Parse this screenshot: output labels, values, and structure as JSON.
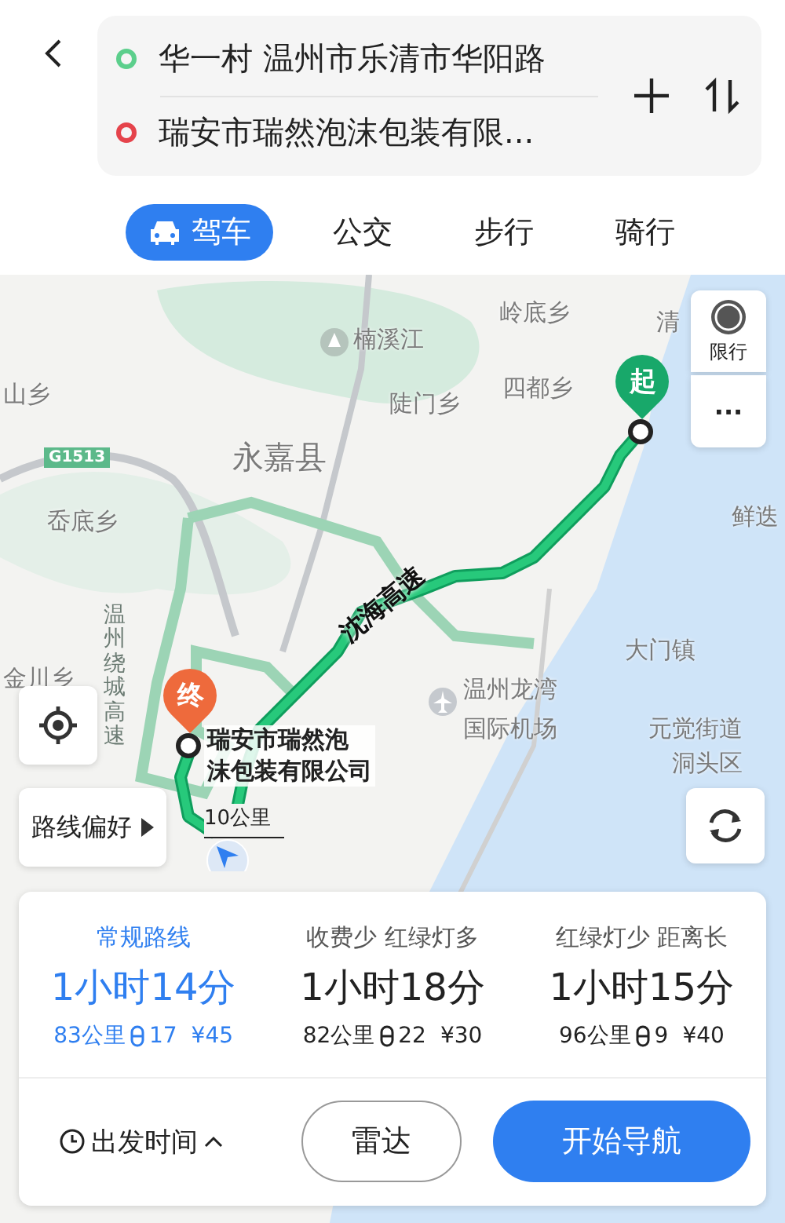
{
  "search": {
    "origin": "华一村 温州市乐清市华阳路",
    "destination": "瑞安市瑞然泡沫包装有限..."
  },
  "tabs": [
    {
      "label": "驾车",
      "selected": true
    },
    {
      "label": "公交",
      "selected": false
    },
    {
      "label": "步行",
      "selected": false
    },
    {
      "label": "骑行",
      "selected": false
    }
  ],
  "map": {
    "places": [
      "岭底乡",
      "清",
      "楠溪江",
      "山乡",
      "四都乡",
      "陡门乡",
      "永嘉县",
      "岙底乡",
      "鲜迭",
      "大门镇",
      "金川乡",
      "温州龙湾",
      "国际机场",
      "元觉街道",
      "洞头区"
    ],
    "road_badge": "G1513",
    "route_name": "沈海高速",
    "ring_road": "温州绕城高速",
    "start_pin": "起",
    "end_pin": "终",
    "destination_label": [
      "瑞安市瑞然泡",
      "沫包装有限公司"
    ],
    "scale": "10公里"
  },
  "side_buttons": {
    "restriction": "限行",
    "more": "···",
    "preference": "路线偏好"
  },
  "routes": [
    {
      "tag": "常规路线",
      "time": "1小时14分",
      "distance": "83公里",
      "lights": "17",
      "toll": "¥45",
      "selected": true
    },
    {
      "tag": "收费少 红绿灯多",
      "time": "1小时18分",
      "distance": "82公里",
      "lights": "22",
      "toll": "¥30",
      "selected": false
    },
    {
      "tag": "红绿灯少 距离长",
      "time": "1小时15分",
      "distance": "96公里",
      "lights": "9",
      "toll": "¥40",
      "selected": false
    }
  ],
  "footer": {
    "depart": "出发时间",
    "radar": "雷达",
    "start": "开始导航"
  }
}
